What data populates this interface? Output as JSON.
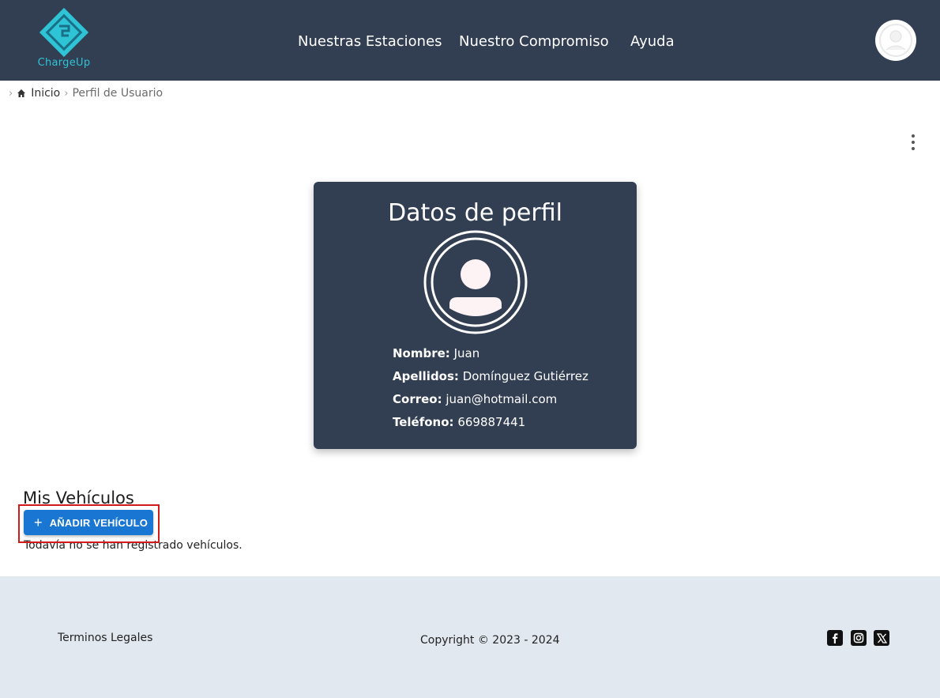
{
  "header": {
    "logo_text": "ChargeUp",
    "nav": [
      "Nuestras Estaciones",
      "Nuestro Compromiso",
      "Ayuda"
    ],
    "colors": {
      "bar": "#323e52",
      "logo": "#2ec4d6"
    }
  },
  "breadcrumb": {
    "home": "Inicio",
    "current": "Perfil de Usuario"
  },
  "profile": {
    "title": "Datos de perfil",
    "fields": [
      {
        "label": "Nombre:",
        "value": "Juan"
      },
      {
        "label": "Apellidos:",
        "value": "Domínguez Gutiérrez"
      },
      {
        "label": "Correo:",
        "value": "juan@hotmail.com"
      },
      {
        "label": "Teléfono:",
        "value": "669887441"
      }
    ]
  },
  "vehicles": {
    "title": "Mis Vehículos",
    "add_button": "AÑADIR VEHÍCULO",
    "empty_text": "Todavía no se han registrado vehículos."
  },
  "footer": {
    "legal": "Terminos Legales",
    "copyright": "Copyright © 2023 - 2024",
    "social_icons": [
      "facebook-icon",
      "instagram-icon",
      "x-icon"
    ]
  }
}
